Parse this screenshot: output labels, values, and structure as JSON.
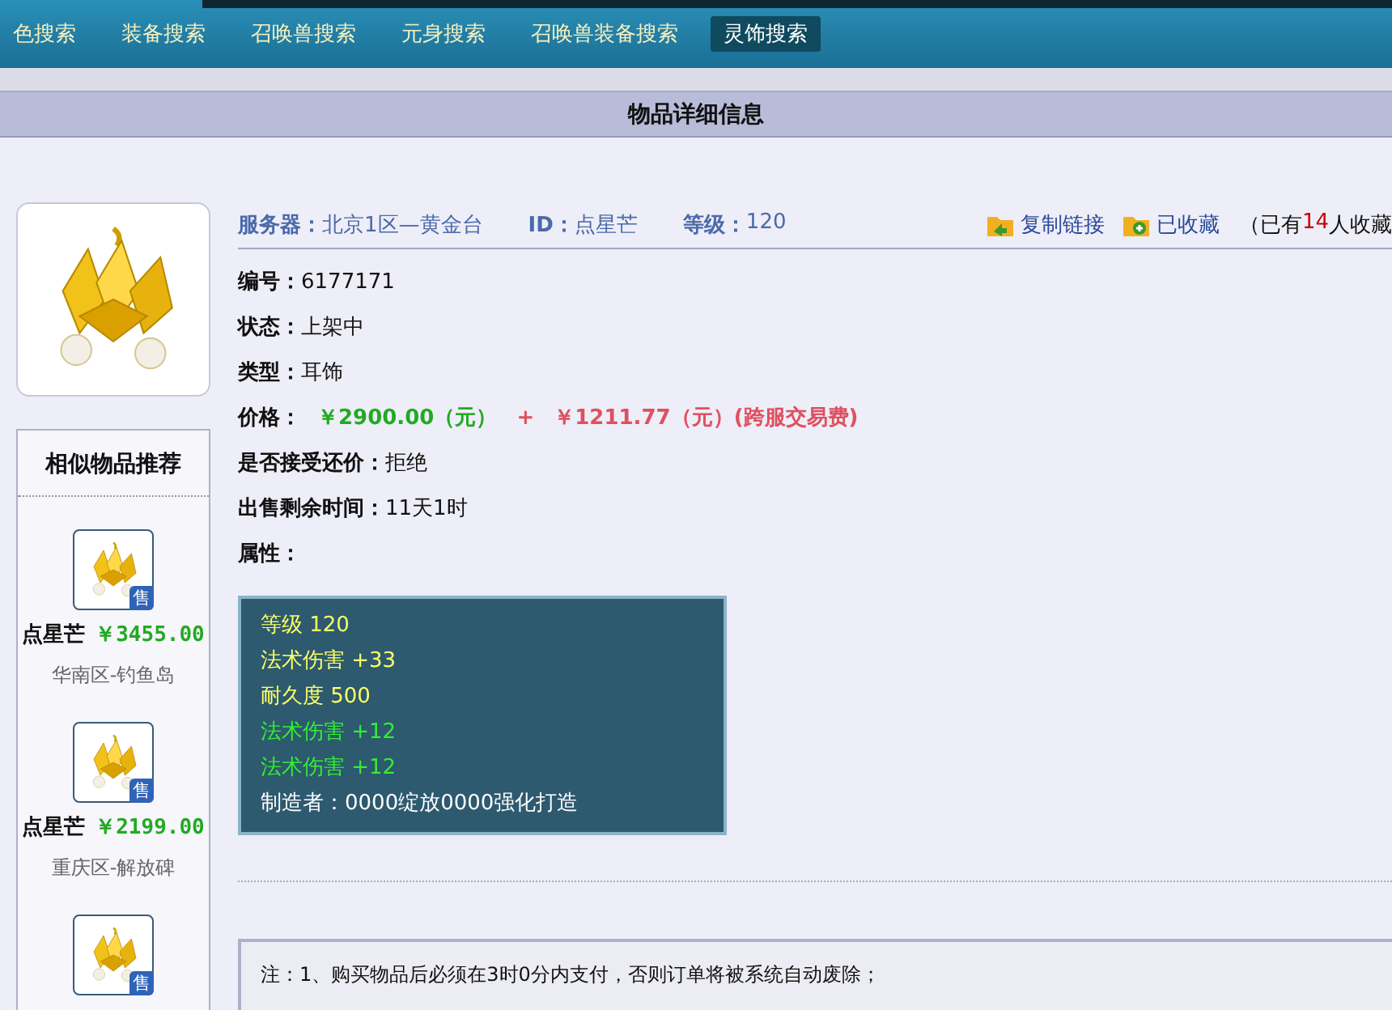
{
  "nav": {
    "tabs": [
      {
        "label": "色搜索",
        "selected": false
      },
      {
        "label": "装备搜索",
        "selected": false
      },
      {
        "label": "召唤兽搜索",
        "selected": false
      },
      {
        "label": "元身搜索",
        "selected": false
      },
      {
        "label": "召唤兽装备搜索",
        "selected": false
      },
      {
        "label": "灵饰搜索",
        "selected": true
      }
    ]
  },
  "title": "物品详细信息",
  "recommend": {
    "title": "相似物品推荐",
    "items": [
      {
        "badge": "售",
        "name": "点星芒",
        "price": "￥3455.00",
        "server": "华南区-钓鱼岛"
      },
      {
        "badge": "售",
        "name": "点星芒",
        "price": "￥2199.00",
        "server": "重庆区-解放碑"
      },
      {
        "badge": "售"
      }
    ]
  },
  "header": {
    "server_label": "服务器：",
    "server": "北京1区—黄金台",
    "id_label": "ID：",
    "id": "点星芒",
    "level_label": "等级：",
    "level": "120",
    "copy_link": "复制链接",
    "favorite": "已收藏",
    "fav_prefix": "（已有",
    "fav_count": "14",
    "fav_suffix": "人收藏"
  },
  "fields": [
    {
      "kind": "plain",
      "label": "编号：",
      "value": "6177171"
    },
    {
      "kind": "plain",
      "label": "状态：",
      "value": "上架中"
    },
    {
      "kind": "plain",
      "label": "类型：",
      "value": "耳饰"
    },
    {
      "kind": "price",
      "label": "价格：",
      "value": "￥2900.00（元）",
      "plus": "+",
      "fee": "￥1211.77（元）(跨服交易费)"
    },
    {
      "kind": "plain",
      "label": "是否接受还价：",
      "value": "拒绝"
    },
    {
      "kind": "plain",
      "label": "出售剩余时间：",
      "value": "11天1时"
    },
    {
      "kind": "plain",
      "label": "属性："
    }
  ],
  "attributes": [
    {
      "text": "等级 120",
      "color": "#ffff66"
    },
    {
      "text": "法术伤害 +33",
      "color": "#ffff66"
    },
    {
      "text": "耐久度 500",
      "color": "#ffff66"
    },
    {
      "text": "法术伤害 +12",
      "color": "#33ee33"
    },
    {
      "text": "法术伤害 +12",
      "color": "#33ee33"
    },
    {
      "text": "制造者：0000绽放0000强化打造",
      "color": "#ffffff"
    }
  ],
  "note": "注：1、购买物品后必须在3时0分内支付，否则订单将被系统自动废除；"
}
